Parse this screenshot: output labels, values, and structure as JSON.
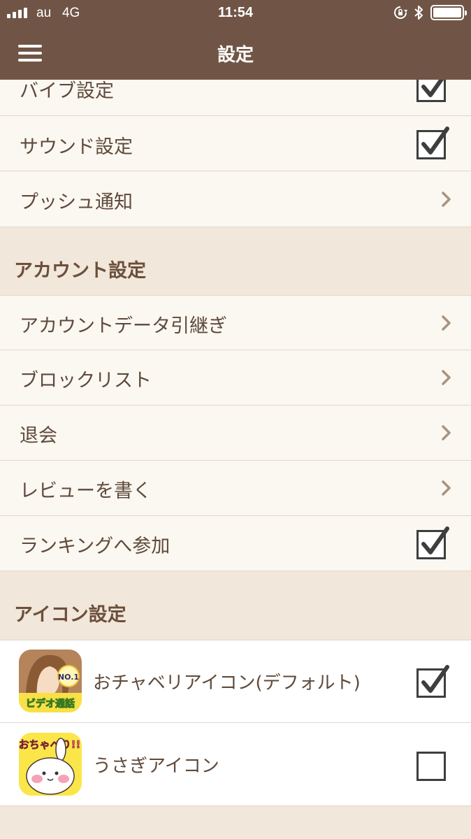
{
  "status_bar": {
    "carrier": "au",
    "network": "4G",
    "time": "11:54",
    "battery_level": 1.0
  },
  "nav": {
    "title": "設定",
    "menu_icon": "hamburger-menu-icon"
  },
  "settings": {
    "top_rows": [
      {
        "label": "バイブ設定",
        "control": "checkbox",
        "checked": true
      },
      {
        "label": "サウンド設定",
        "control": "checkbox",
        "checked": true
      },
      {
        "label": "プッシュ通知",
        "control": "chevron"
      }
    ],
    "account_section": {
      "header": "アカウント設定",
      "rows": [
        {
          "label": "アカウントデータ引継ぎ",
          "control": "chevron"
        },
        {
          "label": "ブロックリスト",
          "control": "chevron"
        },
        {
          "label": "退会",
          "control": "chevron"
        },
        {
          "label": "レビューを書く",
          "control": "chevron"
        },
        {
          "label": "ランキングへ参加",
          "control": "checkbox",
          "checked": true
        }
      ]
    },
    "icon_section": {
      "header": "アイコン設定",
      "options": [
        {
          "label": "おチャベリアイコン(デフォルト)",
          "checked": true,
          "icon_badge": "NO.1",
          "icon_caption": "ビデオ通話"
        },
        {
          "label": "うさぎアイコン",
          "checked": false,
          "icon_caption": "おちゃべり!!"
        }
      ]
    }
  },
  "colors": {
    "header_brown": "#705546",
    "row_background": "#fbf7f1",
    "section_background": "#f1e7da",
    "text_brown": "#5e4a3b",
    "chevron": "#a8947e"
  }
}
